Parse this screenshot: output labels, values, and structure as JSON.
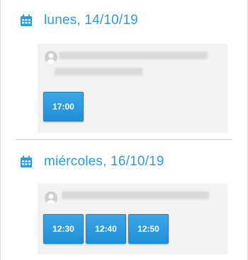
{
  "days": [
    {
      "date_label": "lunes, 14/10/19",
      "times": [
        "17:00"
      ]
    },
    {
      "date_label": "miércoles, 16/10/19",
      "times": [
        "12:30",
        "12:40",
        "12:50"
      ]
    }
  ],
  "colors": {
    "accent": "#2b9be0",
    "button": "#2196dc",
    "card_bg": "#f2f2f2",
    "divider": "#cfcfcf"
  },
  "icons": {
    "calendar": "calendar-icon",
    "avatar": "user-avatar-icon"
  }
}
